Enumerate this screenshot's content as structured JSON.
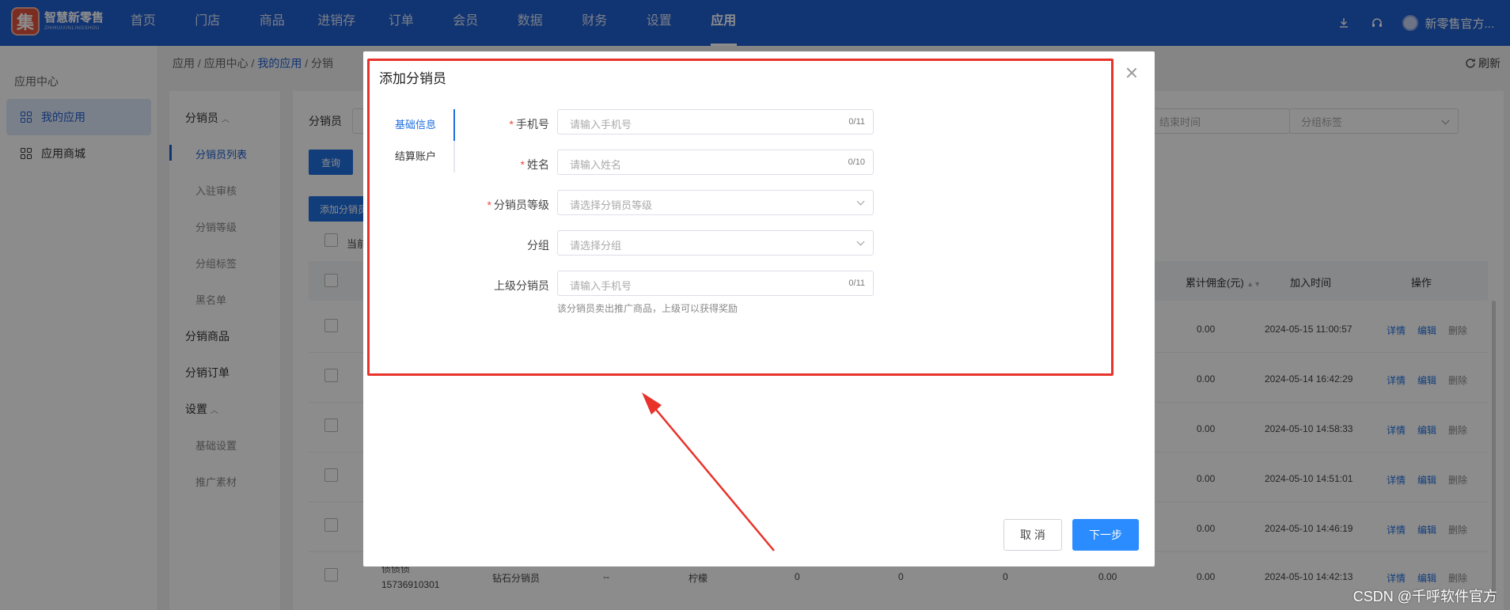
{
  "brand": {
    "logo_char": "集",
    "name": "智慧新零售",
    "sub": "ZHIHUIXINLINGSHOU"
  },
  "nav": {
    "items": [
      "首页",
      "门店",
      "商品",
      "进销存",
      "订单",
      "会员",
      "数据",
      "财务",
      "设置",
      "应用"
    ],
    "active": "应用",
    "user": "新零售官方..."
  },
  "sidebar": {
    "title": "应用中心",
    "items": [
      {
        "label": "我的应用",
        "active": true
      },
      {
        "label": "应用商城",
        "active": false
      }
    ]
  },
  "breadcrumb": {
    "p1": "应用 / 应用中心 / ",
    "current": "我的应用",
    "p2": " / 分销"
  },
  "refresh": "刷新",
  "submenu": {
    "group1": "分销员",
    "group1_items": [
      "分销员列表",
      "入驻审核",
      "分销等级",
      "分组标签",
      "黑名单"
    ],
    "group2": "分销商品",
    "group3": "分销订单",
    "group4": "设置",
    "group4_items": [
      "基础设置",
      "推广素材"
    ]
  },
  "main": {
    "filter_label": "分销员",
    "query_button": "查询",
    "add_button": "添加分销员",
    "end_time_placeholder": "结束时间",
    "group_tag_placeholder": "分组标签",
    "select_current": "当前",
    "columns": {
      "commission": "累计佣金(元)",
      "join_time": "加入时间",
      "ops": "操作"
    },
    "rows": [
      {
        "commission": "0.00",
        "time": "2024-05-15 11:00:57"
      },
      {
        "commission": "0.00",
        "time": "2024-05-14 16:42:29"
      },
      {
        "commission": "0.00",
        "time": "2024-05-10 14:58:33"
      },
      {
        "commission": "0.00",
        "time": "2024-05-10 14:51:01"
      },
      {
        "commission": "0.00",
        "time": "2024-05-10 14:46:19"
      },
      {
        "commission": "0.00",
        "time": "2024-05-10 14:42:13"
      }
    ],
    "last_row": {
      "name": "债债债",
      "phone": "15736910301",
      "level": "钻石分销员",
      "dash": "--",
      "group": "柠檬",
      "c1": "0",
      "c2": "0",
      "c3": "0"
    },
    "ops": {
      "detail": "详情",
      "edit": "编辑",
      "delete": "删除"
    }
  },
  "modal": {
    "title": "添加分销员",
    "tabs": [
      "基础信息",
      "结算账户"
    ],
    "active_tab": "基础信息",
    "fields": [
      {
        "label": "手机号",
        "required": true,
        "placeholder": "请输入手机号",
        "count": "0/11"
      },
      {
        "label": "姓名",
        "required": true,
        "placeholder": "请输入姓名",
        "count": "0/10"
      },
      {
        "label": "分销员等级",
        "required": true,
        "placeholder": "请选择分销员等级"
      },
      {
        "label": "分组",
        "required": false,
        "placeholder": "请选择分组"
      },
      {
        "label": "上级分销员",
        "required": false,
        "placeholder": "请输入手机号",
        "count": "0/11"
      }
    ],
    "hint": "该分销员卖出推广商品，上级可以获得奖励",
    "cancel": "取 消",
    "next": "下一步"
  },
  "annotation_color": "#e8322a",
  "watermark": "CSDN @千呼软件官方"
}
